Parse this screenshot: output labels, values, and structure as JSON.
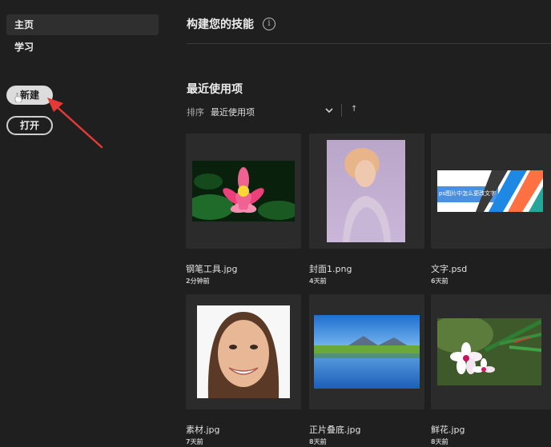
{
  "sidebar": {
    "items": [
      {
        "label": "主页"
      },
      {
        "label": "学习"
      }
    ],
    "new_button": "新建",
    "open_button": "打开"
  },
  "main": {
    "title": "构建您的技能",
    "info_icon": "i",
    "recent_title": "最近使用项",
    "sort_label": "排序",
    "sort_value": "最近使用项",
    "sort_direction": "↑",
    "files": [
      {
        "name": "钢笔工具.jpg",
        "time": "2分钟前"
      },
      {
        "name": "封面1.png",
        "time": "4天前"
      },
      {
        "name": "文字.psd",
        "time": "6天前",
        "thumb_text": "ps图片中怎么更改文字"
      },
      {
        "name": "素材.jpg",
        "time": "7天前"
      },
      {
        "name": "正片叠底.jpg",
        "time": "8天前"
      },
      {
        "name": "鲜花.jpg",
        "time": "8天前"
      }
    ]
  },
  "colors": {
    "background": "#1f1f1f",
    "card": "#2b2b2b",
    "annotation_arrow": "#e53935"
  }
}
